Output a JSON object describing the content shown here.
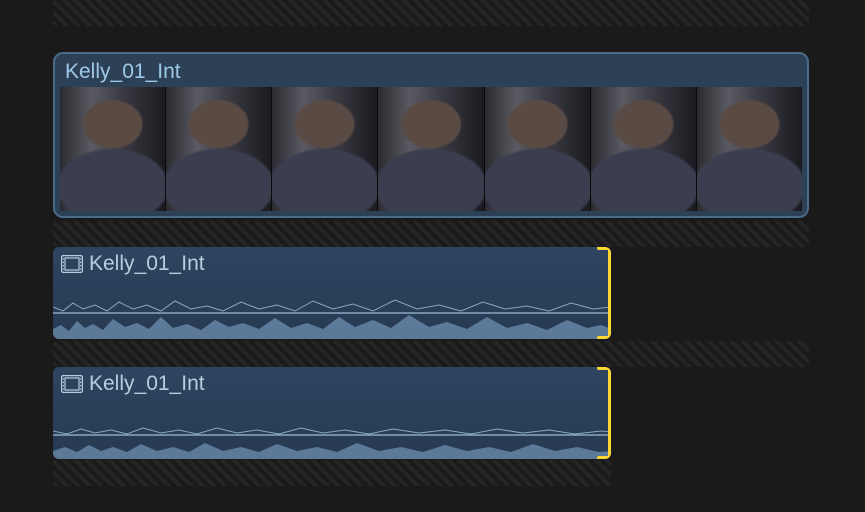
{
  "colors": {
    "selection": "#4a6a8a",
    "edit_marker": "#ffd633",
    "clip_fill": "#2c4056",
    "text": "#9ec8e8",
    "background": "#1a1a1a"
  },
  "video_clip": {
    "name": "Kelly_01_Int",
    "selected": true,
    "frame_count": 7
  },
  "audio_clips": [
    {
      "name": "Kelly_01_Int",
      "has_edit_point_right": true
    },
    {
      "name": "Kelly_01_Int",
      "has_edit_point_right": true
    }
  ]
}
